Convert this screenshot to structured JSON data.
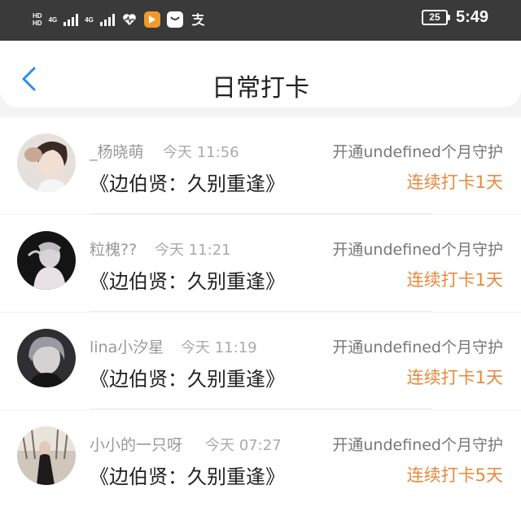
{
  "status_bar": {
    "hd1": "HD",
    "hd2": "HD",
    "net1": "4G",
    "net2": "4G",
    "battery": "25",
    "time": "5:49",
    "icons": [
      "heart-pulse-icon",
      "video-play-icon",
      "bag-icon",
      "alipay-icon"
    ]
  },
  "nav": {
    "title": "日常打卡",
    "back_icon": "chevron-left-icon",
    "accent": "#2a8cf0"
  },
  "checkins": [
    {
      "name": "_杨晓萌",
      "time": "今天 11:56",
      "guard": "开通undefined个月守护",
      "book": "《边伯贤：久别重逢》",
      "streak": "连续打卡1天"
    },
    {
      "name": "粒槐??",
      "time": "今天 11:21",
      "guard": "开通undefined个月守护",
      "book": "《边伯贤：久别重逢》",
      "streak": "连续打卡1天"
    },
    {
      "name": "lina小汐星",
      "time": "今天 11:19",
      "guard": "开通undefined个月守护",
      "book": "《边伯贤：久别重逢》",
      "streak": "连续打卡1天"
    },
    {
      "name": "小小的一只呀",
      "time": "今天 07:27",
      "guard": "开通undefined个月守护",
      "book": "《边伯贤：久别重逢》",
      "streak": "连续打卡5天"
    }
  ],
  "colors": {
    "streak": "#e6893f",
    "status_bar": "#3a3a3a"
  }
}
